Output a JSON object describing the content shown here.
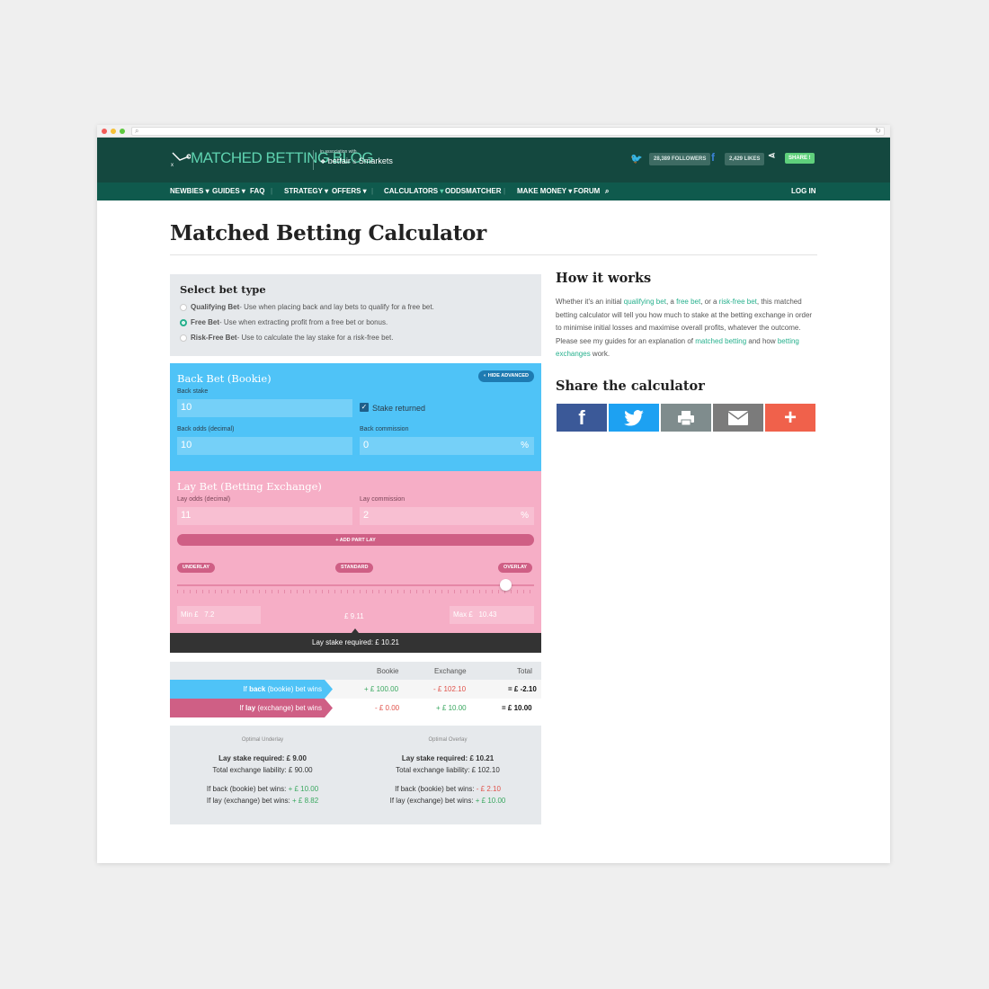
{
  "header": {
    "logo_text": "MATCHED BETTING BLOG",
    "assoc_label": "in association with",
    "partner1": "betfair",
    "partner_sep": "&",
    "partner2": "Smarkets",
    "twitter_followers": "28,389 FOLLOWERS",
    "facebook_likes": "2,429 LIKES",
    "share_label": "SHARE !"
  },
  "nav": {
    "newbies": "NEWBIES",
    "guides": "GUIDES",
    "faq": "FAQ",
    "strategy": "STRATEGY",
    "offers": "OFFERS",
    "calculators": "CALCULATORS",
    "oddsmatcher": "ODDSMATCHER",
    "make_money": "MAKE MONEY",
    "forum": "FORUM",
    "login": "LOG IN"
  },
  "page_title": "Matched Betting Calculator",
  "bet_type": {
    "title": "Select bet type",
    "options": [
      {
        "name": "Qualifying Bet",
        "desc": " - Use when placing back and lay bets to qualify for a free bet.",
        "selected": false
      },
      {
        "name": "Free Bet",
        "desc": " - Use when extracting profit from a free bet or bonus.",
        "selected": true
      },
      {
        "name": "Risk-Free Bet",
        "desc": " - Use to calculate the lay stake for a risk-free bet.",
        "selected": false
      }
    ]
  },
  "back": {
    "title": "Back Bet (Bookie)",
    "hide_advanced": "HIDE ADVANCED",
    "stake_label": "Back stake",
    "stake": "10",
    "stake_returned": "Stake returned",
    "odds_label": "Back odds (decimal)",
    "odds": "10",
    "commission_label": "Back commission",
    "commission": "0",
    "pct": "%"
  },
  "lay": {
    "title": "Lay Bet (Betting Exchange)",
    "odds_label": "Lay odds (decimal)",
    "odds": "11",
    "commission_label": "Lay commission",
    "commission": "2",
    "pct": "%",
    "add_part": "+ ADD PART LAY",
    "underlay": "UNDERLAY",
    "standard": "STANDARD",
    "overlay": "OVERLAY",
    "slider_position": 0.92,
    "min_label": "Min £",
    "min_value": "7.2",
    "mid_value": "£ 9.11",
    "max_label": "Max £",
    "max_value": "10.43",
    "required": "Lay stake required: £ 10.21"
  },
  "results": {
    "headers": [
      "Bookie",
      "Exchange",
      "Total"
    ],
    "back_row": {
      "label_pre": "If ",
      "label_bold": "back",
      "label_post": " (bookie) bet wins",
      "bookie": "+ £ 100.00",
      "exchange": "- £ 102.10",
      "total": "= £ -2.10"
    },
    "lay_row": {
      "label_pre": "If ",
      "label_bold": "lay",
      "label_post": " (exchange) bet wins",
      "bookie": "- £ 0.00",
      "exchange": "+ £ 10.00",
      "total": "= £ 10.00"
    }
  },
  "optimal": {
    "underlay": {
      "title": "Optimal Underlay",
      "stake": "Lay stake required: £ 9.00",
      "liability": "Total exchange liability: £ 90.00",
      "back_label": "If back (bookie) bet wins: ",
      "back_val": "+ £ 10.00",
      "lay_label": "If lay (exchange) bet wins: ",
      "lay_val": "+ £ 8.82"
    },
    "overlay": {
      "title": "Optimal Overlay",
      "stake": "Lay stake required: £ 10.21",
      "liability": "Total exchange liability: £ 102.10",
      "back_label": "If back (bookie) bet wins: ",
      "back_val": "- £ 2.10",
      "lay_label": "If lay (exchange) bet wins: ",
      "lay_val": "+ £ 10.00"
    }
  },
  "sidebar": {
    "how_title": "How it works",
    "p1": "Whether it's an initial ",
    "link_qualifying": "qualifying bet",
    "p2": ", a ",
    "link_free": "free bet",
    "p3": ", or a ",
    "link_riskfree": "risk-free bet",
    "p4": ", this matched betting calculator will tell you how much to stake at the betting exchange in order to minimise initial losses and maximise overall profits, whatever the outcome. Please see my guides for an explanation of ",
    "link_matched": "matched betting",
    "p5": " and how ",
    "link_exchanges": "betting exchanges",
    "p6": " work.",
    "share_title": "Share the calculator"
  },
  "colors": {
    "header": "#14483f",
    "nav": "#0f5a4d",
    "accent": "#26b08d",
    "back": "#4fc3f7",
    "lay": "#f6aec6",
    "lay_dark": "#cf5f85",
    "facebook": "#3b5998",
    "twitter": "#1da1f2",
    "print": "#7f8c8d",
    "email": "#7b7b7b",
    "plus": "#f0614b"
  }
}
